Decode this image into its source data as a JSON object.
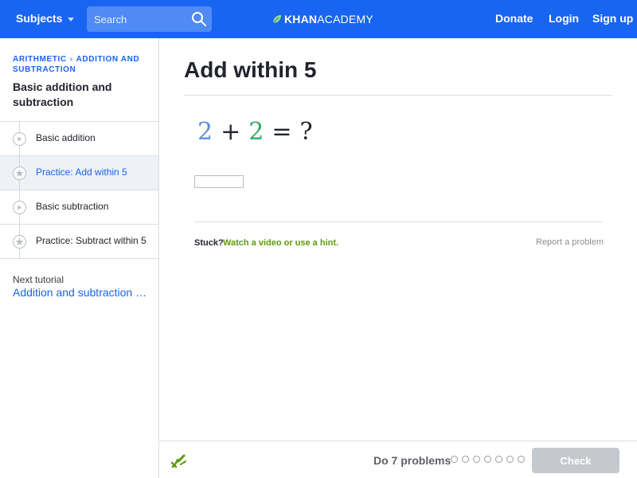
{
  "header": {
    "subjects_label": "Subjects",
    "search_placeholder": "Search",
    "logo_part1": "KHAN",
    "logo_part2": "ACADEMY",
    "donate_label": "Donate",
    "login_label": "Login",
    "signup_label": "Sign up"
  },
  "sidebar": {
    "breadcrumb": {
      "parent": "ARITHMETIC",
      "current": "ADDITION AND SUBTRACTION"
    },
    "tutorial_title": "Basic addition and subtraction",
    "items": [
      {
        "label": "Basic addition",
        "type": "video",
        "icon": "play-icon"
      },
      {
        "label": "Practice: Add within 5",
        "type": "exercise",
        "icon": "star-icon",
        "active": true
      },
      {
        "label": "Basic subtraction",
        "type": "video",
        "icon": "play-icon"
      },
      {
        "label": "Practice: Subtract within 5",
        "type": "exercise",
        "icon": "star-icon"
      }
    ],
    "next_tutorial_label": "Next tutorial",
    "next_tutorial_title": "Addition and subtraction w…"
  },
  "exercise": {
    "title": "Add within 5",
    "problem": {
      "a": "2",
      "op": "+",
      "b": "2",
      "eq": "=",
      "q": "?"
    },
    "answer_value": "",
    "stuck_label": "Stuck?",
    "hint_link": "Watch a video or use a hint.",
    "report_label": "Report a problem"
  },
  "footer": {
    "do_problems_label": "Do 7 problems",
    "problem_count": 7,
    "completed": 0,
    "check_label": "Check"
  },
  "colors": {
    "nav_bg": "#1865f2",
    "link_blue": "#1865f2",
    "hint_green": "#5d9a0e",
    "operand_blue": "#5b8fd9",
    "operand_green": "#2faa6b",
    "check_disabled": "#c5c8cd"
  }
}
